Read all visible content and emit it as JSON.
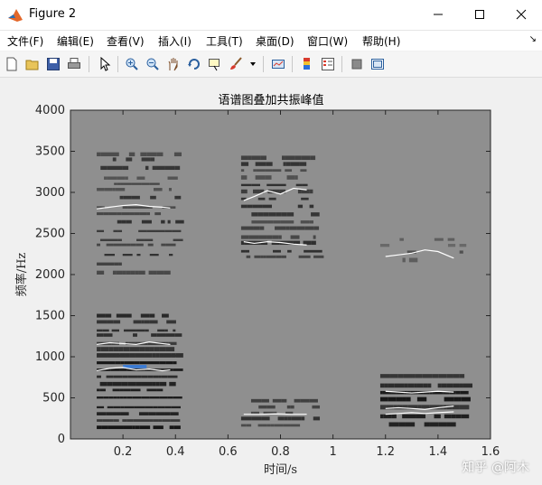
{
  "window": {
    "title": "Figure 2",
    "app_icon": "matlab-icon",
    "controls": [
      "minimize-icon",
      "maximize-icon",
      "close-icon"
    ]
  },
  "menu": {
    "items": [
      "文件(F)",
      "编辑(E)",
      "查看(V)",
      "插入(I)",
      "工具(T)",
      "桌面(D)",
      "窗口(W)",
      "帮助(H)"
    ],
    "overflow_arrow": "↘"
  },
  "toolbar": {
    "buttons": [
      "new-figure-icon",
      "open-file-icon",
      "save-icon",
      "print-icon",
      "pointer-icon",
      "zoom-in-icon",
      "zoom-out-icon",
      "pan-icon",
      "rotate-3d-icon",
      "data-cursor-icon",
      "brush-icon",
      "link-plot-icon",
      "colorbar-icon",
      "legend-icon",
      "hide-tools-icon",
      "show-tools-icon"
    ]
  },
  "colors": {
    "plot_background": "#8f8f8f",
    "formant_line": "#ffffff",
    "highlight": "#3a7bd5"
  },
  "chart_data": {
    "type": "heatmap",
    "title": "语谱图叠加共振峰值",
    "xlabel": "时间/s",
    "ylabel": "频率/Hz",
    "xlim": [
      0,
      1.6
    ],
    "ylim": [
      0,
      4000
    ],
    "xticks": [
      0.2,
      0.4,
      0.6,
      0.8,
      1,
      1.2,
      1.4,
      1.6
    ],
    "yticks": [
      0,
      500,
      1000,
      1500,
      2000,
      2500,
      3000,
      3500,
      4000
    ],
    "grid": false,
    "segments": [
      {
        "time_range": [
          0.1,
          0.4
        ],
        "formants": [
          {
            "x": [
              0.1,
              0.15,
              0.2,
              0.25,
              0.3,
              0.35,
              0.38
            ],
            "y": [
              830,
              860,
              870,
              840,
              850,
              830,
              840
            ]
          },
          {
            "x": [
              0.1,
              0.15,
              0.2,
              0.25,
              0.3,
              0.35,
              0.38
            ],
            "y": [
              1150,
              1170,
              1160,
              1150,
              1180,
              1160,
              1150
            ]
          },
          {
            "x": [
              0.1,
              0.15,
              0.2,
              0.25,
              0.3,
              0.35,
              0.38
            ],
            "y": [
              2800,
              2820,
              2840,
              2850,
              2830,
              2820,
              2810
            ]
          }
        ]
      },
      {
        "time_range": [
          0.65,
          0.93
        ],
        "formants": [
          {
            "x": [
              0.66,
              0.72,
              0.78,
              0.84,
              0.9
            ],
            "y": [
              300,
              300,
              305,
              300,
              300
            ]
          },
          {
            "x": [
              0.66,
              0.7,
              0.75,
              0.8,
              0.85,
              0.9
            ],
            "y": [
              2400,
              2380,
              2400,
              2390,
              2370,
              2360
            ]
          },
          {
            "x": [
              0.66,
              0.7,
              0.75,
              0.8,
              0.85,
              0.9
            ],
            "y": [
              2900,
              2950,
              3020,
              2980,
              3050,
              3030
            ]
          }
        ]
      },
      {
        "time_range": [
          1.18,
          1.5
        ],
        "formants": [
          {
            "x": [
              1.2,
              1.25,
              1.3,
              1.35,
              1.4,
              1.46
            ],
            "y": [
              300,
              310,
              320,
              310,
              320,
              330
            ]
          },
          {
            "x": [
              1.2,
              1.25,
              1.3,
              1.35,
              1.4,
              1.46
            ],
            "y": [
              370,
              380,
              370,
              360,
              380,
              400
            ]
          },
          {
            "x": [
              1.2,
              1.25,
              1.3,
              1.35,
              1.4,
              1.46
            ],
            "y": [
              580,
              570,
              560,
              570,
              580,
              570
            ]
          },
          {
            "x": [
              1.2,
              1.25,
              1.3,
              1.35,
              1.4,
              1.46
            ],
            "y": [
              2220,
              2240,
              2260,
              2300,
              2280,
              2200
            ]
          }
        ]
      }
    ]
  },
  "watermark": "知乎 @阿木"
}
